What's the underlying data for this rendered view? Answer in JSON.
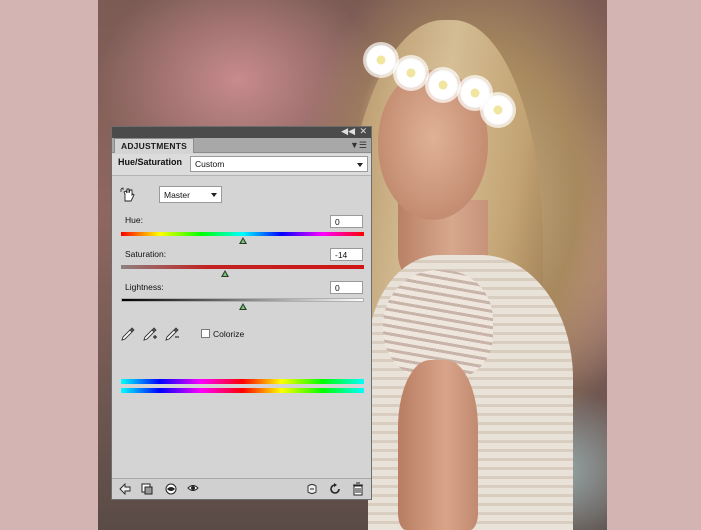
{
  "panel": {
    "tab_label": "ADJUSTMENTS",
    "adjustment_title": "Hue/Saturation",
    "preset_value": "Custom",
    "channel_value": "Master",
    "hue": {
      "label": "Hue:",
      "value": "0",
      "position": 0.5
    },
    "saturation": {
      "label": "Saturation:",
      "value": "-14",
      "position": 0.43
    },
    "lightness": {
      "label": "Lightness:",
      "value": "0",
      "position": 0.5
    },
    "colorize_label": "Colorize",
    "colorize_checked": false,
    "icons": {
      "hand_tool": "targeted-adjustment-hand-icon",
      "eyedroppers": [
        "eyedropper-icon",
        "eyedropper-plus-icon",
        "eyedropper-minus-icon"
      ],
      "footer_left": [
        "back-arrow-icon",
        "clip-to-layer-icon",
        "eye-visibility-icon",
        "view-previous-icon"
      ],
      "footer_right": [
        "reset-icon",
        "refresh-icon",
        "trash-icon"
      ]
    }
  }
}
